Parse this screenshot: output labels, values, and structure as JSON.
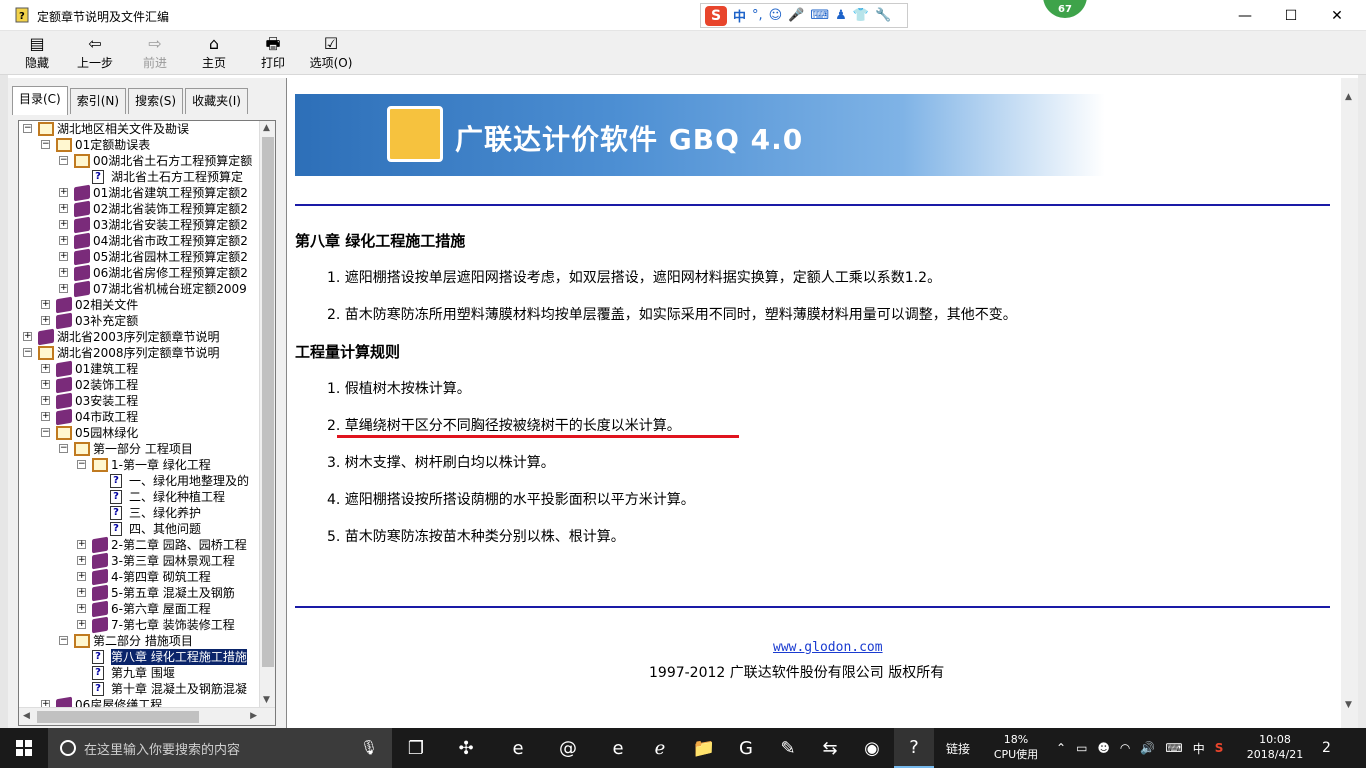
{
  "window": {
    "title": "定额章节说明及文件汇编",
    "controls": [
      "minimize",
      "maximize",
      "close"
    ]
  },
  "ime": {
    "mode": "中",
    "badge": "67"
  },
  "toolbar": {
    "hide": "隐藏",
    "back": "上一步",
    "forward": "前进",
    "home": "主页",
    "print": "打印",
    "options": "选项(O)"
  },
  "tabs": [
    "目录(C)",
    "索引(N)",
    "搜索(S)",
    "收藏夹(I)"
  ],
  "tree": [
    {
      "level": 0,
      "tog": "-",
      "icon": "open",
      "label": "湖北地区相关文件及勘误"
    },
    {
      "level": 1,
      "tog": "-",
      "icon": "open",
      "label": "01定额勘误表"
    },
    {
      "level": 2,
      "tog": "-",
      "icon": "open",
      "label": "00湖北省土石方工程预算定额"
    },
    {
      "level": 3,
      "tog": "",
      "icon": "page",
      "label": "湖北省土石方工程预算定"
    },
    {
      "level": 2,
      "tog": "+",
      "icon": "closed",
      "label": "01湖北省建筑工程预算定额2"
    },
    {
      "level": 2,
      "tog": "+",
      "icon": "closed",
      "label": "02湖北省装饰工程预算定额2"
    },
    {
      "level": 2,
      "tog": "+",
      "icon": "closed",
      "label": "03湖北省安装工程预算定额2"
    },
    {
      "level": 2,
      "tog": "+",
      "icon": "closed",
      "label": "04湖北省市政工程预算定额2"
    },
    {
      "level": 2,
      "tog": "+",
      "icon": "closed",
      "label": "05湖北省园林工程预算定额2"
    },
    {
      "level": 2,
      "tog": "+",
      "icon": "closed",
      "label": "06湖北省房修工程预算定额2"
    },
    {
      "level": 2,
      "tog": "+",
      "icon": "closed",
      "label": "07湖北省机械台班定额2009"
    },
    {
      "level": 1,
      "tog": "+",
      "icon": "closed",
      "label": "02相关文件"
    },
    {
      "level": 1,
      "tog": "+",
      "icon": "closed",
      "label": "03补充定额"
    },
    {
      "level": 0,
      "tog": "+",
      "icon": "closed",
      "label": "湖北省2003序列定额章节说明"
    },
    {
      "level": 0,
      "tog": "-",
      "icon": "open",
      "label": "湖北省2008序列定额章节说明"
    },
    {
      "level": 1,
      "tog": "+",
      "icon": "closed",
      "label": "01建筑工程"
    },
    {
      "level": 1,
      "tog": "+",
      "icon": "closed",
      "label": "02装饰工程"
    },
    {
      "level": 1,
      "tog": "+",
      "icon": "closed",
      "label": "03安装工程"
    },
    {
      "level": 1,
      "tog": "+",
      "icon": "closed",
      "label": "04市政工程"
    },
    {
      "level": 1,
      "tog": "-",
      "icon": "open",
      "label": "05园林绿化"
    },
    {
      "level": 2,
      "tog": "-",
      "icon": "open",
      "label": "第一部分 工程项目"
    },
    {
      "level": 3,
      "tog": "-",
      "icon": "open",
      "label": "1-第一章 绿化工程"
    },
    {
      "level": 4,
      "tog": "",
      "icon": "page",
      "label": "一、绿化用地整理及的"
    },
    {
      "level": 4,
      "tog": "",
      "icon": "page",
      "label": "二、绿化种植工程"
    },
    {
      "level": 4,
      "tog": "",
      "icon": "page",
      "label": "三、绿化养护"
    },
    {
      "level": 4,
      "tog": "",
      "icon": "page",
      "label": "四、其他问题"
    },
    {
      "level": 3,
      "tog": "+",
      "icon": "closed",
      "label": "2-第二章 园路、园桥工程"
    },
    {
      "level": 3,
      "tog": "+",
      "icon": "closed",
      "label": "3-第三章  园林景观工程"
    },
    {
      "level": 3,
      "tog": "+",
      "icon": "closed",
      "label": "4-第四章  砌筑工程"
    },
    {
      "level": 3,
      "tog": "+",
      "icon": "closed",
      "label": "5-第五章  混凝土及钢筋"
    },
    {
      "level": 3,
      "tog": "+",
      "icon": "closed",
      "label": "6-第六章  屋面工程"
    },
    {
      "level": 3,
      "tog": "+",
      "icon": "closed",
      "label": "7-第七章  装饰装修工程"
    },
    {
      "level": 2,
      "tog": "-",
      "icon": "open",
      "label": "第二部分 措施项目"
    },
    {
      "level": 3,
      "tog": "",
      "icon": "page",
      "label": "第八章 绿化工程施工措施",
      "selected": true
    },
    {
      "level": 3,
      "tog": "",
      "icon": "page",
      "label": "第九章 围堰"
    },
    {
      "level": 3,
      "tog": "",
      "icon": "page",
      "label": "第十章 混凝土及钢筋混凝"
    },
    {
      "level": 1,
      "tog": "+",
      "icon": "closed",
      "label": "06房屋修缮工程"
    }
  ],
  "content": {
    "banner_title": "广联达计价软件 GBQ 4.0",
    "chapter_heading": "第八章   绿化工程施工措施",
    "chapter_items": [
      "1. 遮阳棚搭设按单层遮阳网搭设考虑，如双层搭设，遮阳网材料据实换算，定额人工乘以系数1.2。",
      "2. 苗木防寒防冻所用塑料薄膜材料均按单层覆盖，如实际采用不同时，塑料薄膜材料用量可以调整，其他不变。"
    ],
    "rules_heading": "工程量计算规则",
    "rules_items": [
      "1. 假植树木按株计算。",
      "2. 草绳绕树干区分不同胸径按被绕树干的长度以米计算。",
      "3. 树木支撑、树杆刷白均以株计算。",
      "4. 遮阳棚搭设按所搭设荫棚的水平投影面积以平方米计算。",
      "5. 苗木防寒防冻按苗木种类分别以株、根计算。"
    ],
    "footer_link": "www.glodon.com",
    "footer_copyright": "1997-2012 广联达软件股份有限公司 版权所有"
  },
  "taskbar": {
    "search_placeholder": "在这里输入你要搜索的内容",
    "link_label": "链接",
    "cpu_percent": "18%",
    "cpu_label": "CPU使用",
    "ime_lang": "中",
    "time": "10:08",
    "date": "2018/4/21",
    "notifications": "2"
  },
  "colors": {
    "rule_line": "#1a1aa6",
    "highlight_underline": "#e0141e",
    "selection": "#0a246a",
    "link": "#1a3bd0"
  }
}
